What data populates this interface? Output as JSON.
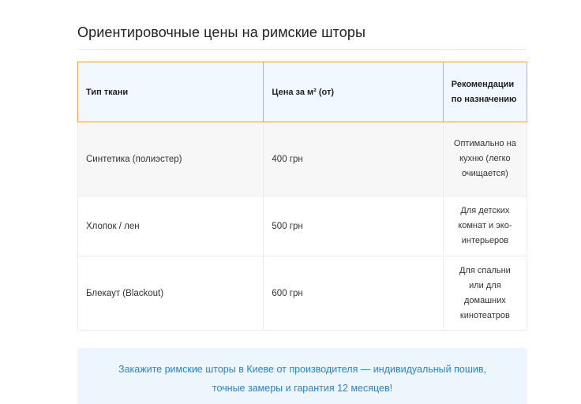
{
  "header": {
    "title": "Ориентировочные цены на римские шторы"
  },
  "table": {
    "columns": [
      "Тип ткани",
      "Цена за м² (от)",
      "Рекомендации по назначению"
    ],
    "rows": [
      {
        "fabric": "Синтетика (полиэстер)",
        "price": "400 грн",
        "recommendation": "Оптимально на кухню (легко очищается)"
      },
      {
        "fabric": "Хлопок / лен",
        "price": "500 грн",
        "recommendation": "Для детских комнат и эко-интерьеров"
      },
      {
        "fabric": "Блекаут (Blackout)",
        "price": "600 грн",
        "recommendation": "Для спальни или для домашних кинотеатров"
      }
    ]
  },
  "cta": {
    "text": "Закажите римские шторы в Киеве от производителя — индивидуальный пошив, точные замеры и гарантия 12 месяцев!"
  },
  "colors": {
    "header_border": "#f3a35c",
    "header_bg": "#f1f8ff",
    "cta_bg": "#eef6fd",
    "cta_text": "#1f87d6"
  }
}
